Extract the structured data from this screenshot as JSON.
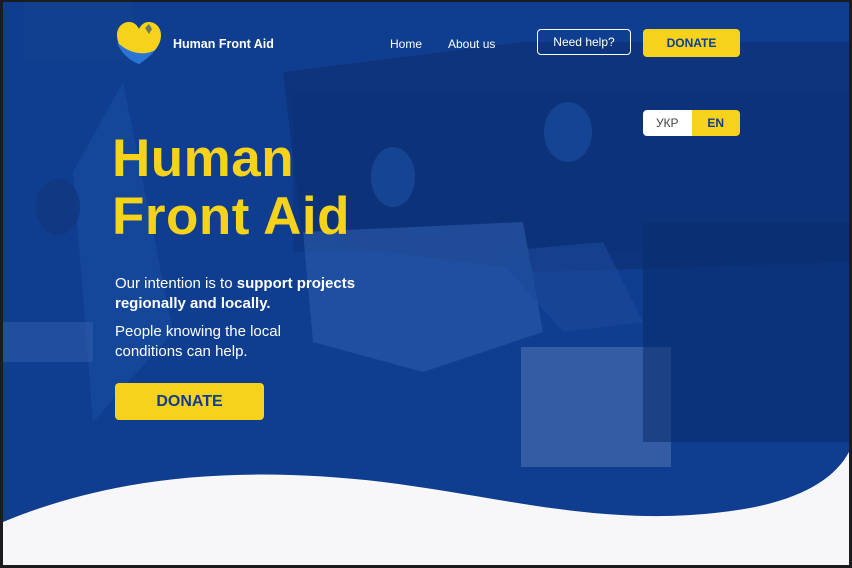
{
  "brand": {
    "name": "Human Front Aid"
  },
  "nav": {
    "links": [
      "Home",
      "About us"
    ],
    "help_label": "Need help?",
    "donate_label": "DONATE"
  },
  "lang": {
    "ua_label": "УКР",
    "en_label": "EN",
    "selected": "EN"
  },
  "hero": {
    "title_line1": "Human",
    "title_line2": "Front Aid",
    "intro_prefix": "Our intention is to ",
    "intro_bold": "support projects regionally and locally.",
    "intro2": "People knowing the local conditions can help.",
    "donate_label": "DONATE"
  },
  "colors": {
    "primary_blue": "#0f3d8f",
    "accent_yellow": "#f6d21b",
    "wave": "#f7f7f9"
  }
}
